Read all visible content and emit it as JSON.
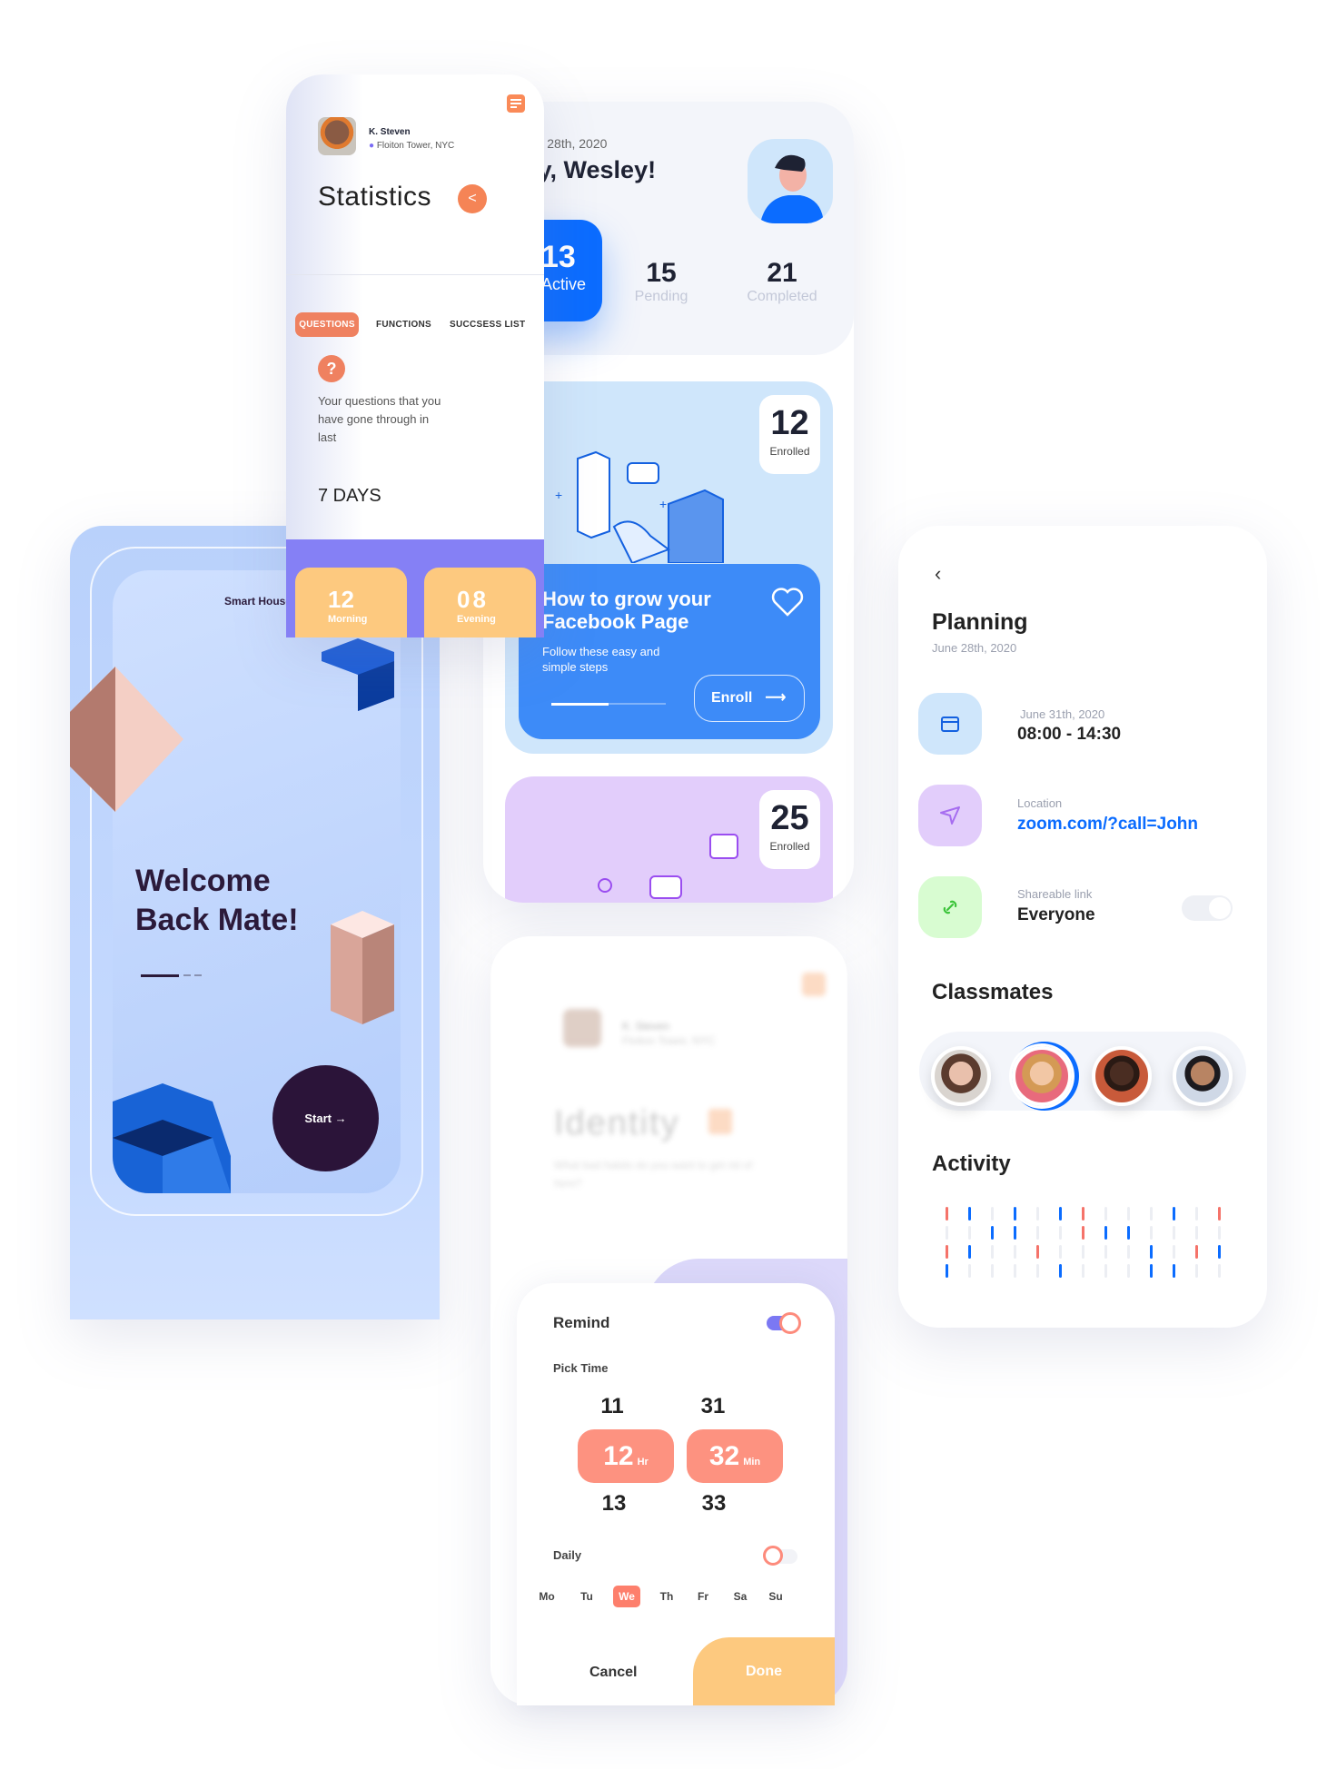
{
  "colors": {
    "accent_orange": "#f0845c",
    "blue": "#0b6cff",
    "coral": "#fd9280",
    "amber": "#fdc97f",
    "purple": "#8580f5"
  },
  "wesley": {
    "date": "June 28th, 2020",
    "greeting": "Hey, Wesley!",
    "stats": [
      {
        "value": "13",
        "label": "Active"
      },
      {
        "value": "15",
        "label": "Pending"
      },
      {
        "value": "21",
        "label": "Completed"
      }
    ],
    "courses": [
      {
        "enrolled": "12",
        "enrolled_label": "Enrolled",
        "title": "How to grow your Facebook Page",
        "subtitle": "Follow these easy and simple steps",
        "progress": 0.5,
        "button": "Enroll"
      },
      {
        "enrolled": "25",
        "enrolled_label": "Enrolled"
      }
    ]
  },
  "statistics": {
    "user": {
      "name": "K. Steven",
      "location": "Floiton Tower, NYC"
    },
    "title": "Statistics",
    "tabs": [
      "QUESTIONS",
      "FUNCTIONS",
      "SUCCSESS LIST"
    ],
    "active_tab": "QUESTIONS",
    "description": "Your questions that you have gone through in last",
    "period": "7 DAYS",
    "counts": [
      {
        "value": "12",
        "label": "Morning"
      },
      {
        "value": "08",
        "label": "Evening"
      }
    ]
  },
  "welcome": {
    "brand": "Smart House",
    "title_line1": "Welcome",
    "title_line2": "Back Mate!",
    "start": "Start →"
  },
  "identity": {
    "user": {
      "name": "K. Steven",
      "location": "Floiton Tower, NYC"
    },
    "title": "Identity",
    "question": "What bad habits do you want to get rid of here?"
  },
  "remind": {
    "title": "Remind",
    "enabled": true,
    "pick_time": "Pick Time",
    "hours": [
      "11",
      "12",
      "13"
    ],
    "minutes": [
      "31",
      "32",
      "33"
    ],
    "hr_unit": "Hr",
    "min_unit": "Min",
    "daily": "Daily",
    "daily_enabled": false,
    "days": [
      "Mo",
      "Tu",
      "We",
      "Th",
      "Fr",
      "Sa",
      "Su"
    ],
    "selected_day": "We",
    "cancel": "Cancel",
    "done": "Done"
  },
  "planning": {
    "title": "Planning",
    "date": "June 28th, 2020",
    "rows": [
      {
        "icon": "calendar-icon",
        "sub": "June 31th, 2020",
        "value": "08:00 - 14:30"
      },
      {
        "icon": "send-icon",
        "sub": "Location",
        "value": "zoom.com/?call=John"
      },
      {
        "icon": "link-icon",
        "sub": "Shareable link",
        "value": "Everyone",
        "toggle": false
      }
    ],
    "classmates_title": "Classmates",
    "classmates_count": 4,
    "selected_classmate": 2,
    "activity_title": "Activity",
    "activity": [
      [
        "r",
        "g",
        "r",
        "b"
      ],
      [
        "b",
        "g",
        "b",
        "g"
      ],
      [
        "g",
        "b",
        "g",
        "g"
      ],
      [
        "b",
        "b",
        "g",
        "g"
      ],
      [
        "g",
        "g",
        "r",
        "g"
      ],
      [
        "b",
        "g",
        "g",
        "b"
      ],
      [
        "r",
        "r",
        "g",
        "g"
      ],
      [
        "g",
        "b",
        "g",
        "g"
      ],
      [
        "g",
        "b",
        "g",
        "g"
      ],
      [
        "g",
        "g",
        "b",
        "b"
      ],
      [
        "b",
        "g",
        "g",
        "b"
      ],
      [
        "g",
        "g",
        "r",
        "g"
      ],
      [
        "r",
        "g",
        "b",
        "g"
      ]
    ]
  }
}
